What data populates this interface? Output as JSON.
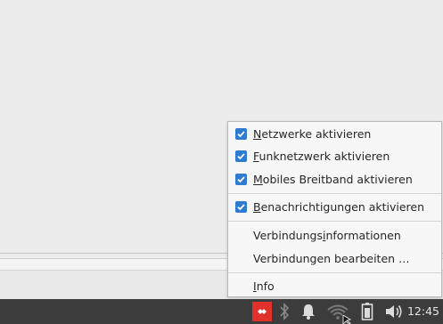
{
  "menu": {
    "items": [
      {
        "prefix": "",
        "mnemonic": "N",
        "suffix": "etzwerke aktivieren",
        "checked": true
      },
      {
        "prefix": "",
        "mnemonic": "F",
        "suffix": "unknetzwerk aktivieren",
        "checked": true
      },
      {
        "prefix": "",
        "mnemonic": "M",
        "suffix": "obiles Breitband aktivieren",
        "checked": true
      },
      {
        "prefix": "",
        "mnemonic": "B",
        "suffix": "enachrichtigungen aktivieren",
        "checked": true
      },
      {
        "prefix": "Verbindungs",
        "mnemonic": "i",
        "suffix": "nformationen",
        "checked": false
      },
      {
        "prefix": "Verbindungen bearbeiten …",
        "mnemonic": "",
        "suffix": "",
        "checked": false
      },
      {
        "prefix": "",
        "mnemonic": "I",
        "suffix": "nfo",
        "checked": false
      }
    ]
  },
  "panel": {
    "clock": "12:45",
    "icons": [
      "anydesk-icon",
      "bluetooth-icon",
      "notification-bell-icon",
      "wifi-icon",
      "battery-icon",
      "volume-icon"
    ]
  },
  "colors": {
    "checkbox": "#2e7bcf",
    "panel": "#3c3c3c",
    "anydesk": "#e0312b"
  }
}
